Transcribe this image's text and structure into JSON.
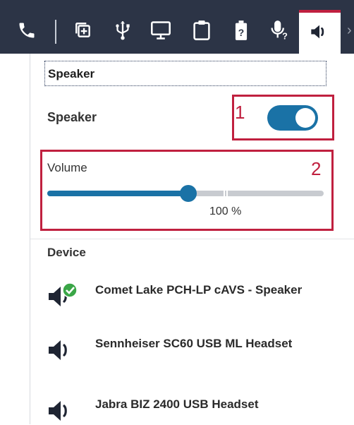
{
  "toolbar": {
    "icons": [
      "phone-icon",
      "add-call-icon",
      "usb-icon",
      "monitor-icon",
      "clipboard-icon",
      "battery-unknown-icon",
      "microphone-help-icon",
      "speaker-icon"
    ],
    "active": "speaker-icon",
    "accent_color": "#c0203f"
  },
  "panel": {
    "title": "Speaker",
    "speaker_toggle": {
      "label": "Speaker",
      "on": true
    },
    "volume": {
      "label": "Volume",
      "value_text": "100 %",
      "level_fraction": 0.51
    },
    "callouts": [
      "1",
      "2"
    ],
    "device_section": {
      "header": "Device",
      "devices": [
        {
          "name": "Comet Lake PCH-LP cAVS - Speaker",
          "selected": true
        },
        {
          "name": "Sennheiser SC60 USB ML Headset",
          "selected": false
        },
        {
          "name": "Jabra BIZ 2400 USB Headset",
          "selected": false
        }
      ]
    }
  },
  "colors": {
    "toolbar_bg": "#2c3446",
    "toggle_on": "#1a72a6",
    "selected_check": "#3aa647"
  }
}
